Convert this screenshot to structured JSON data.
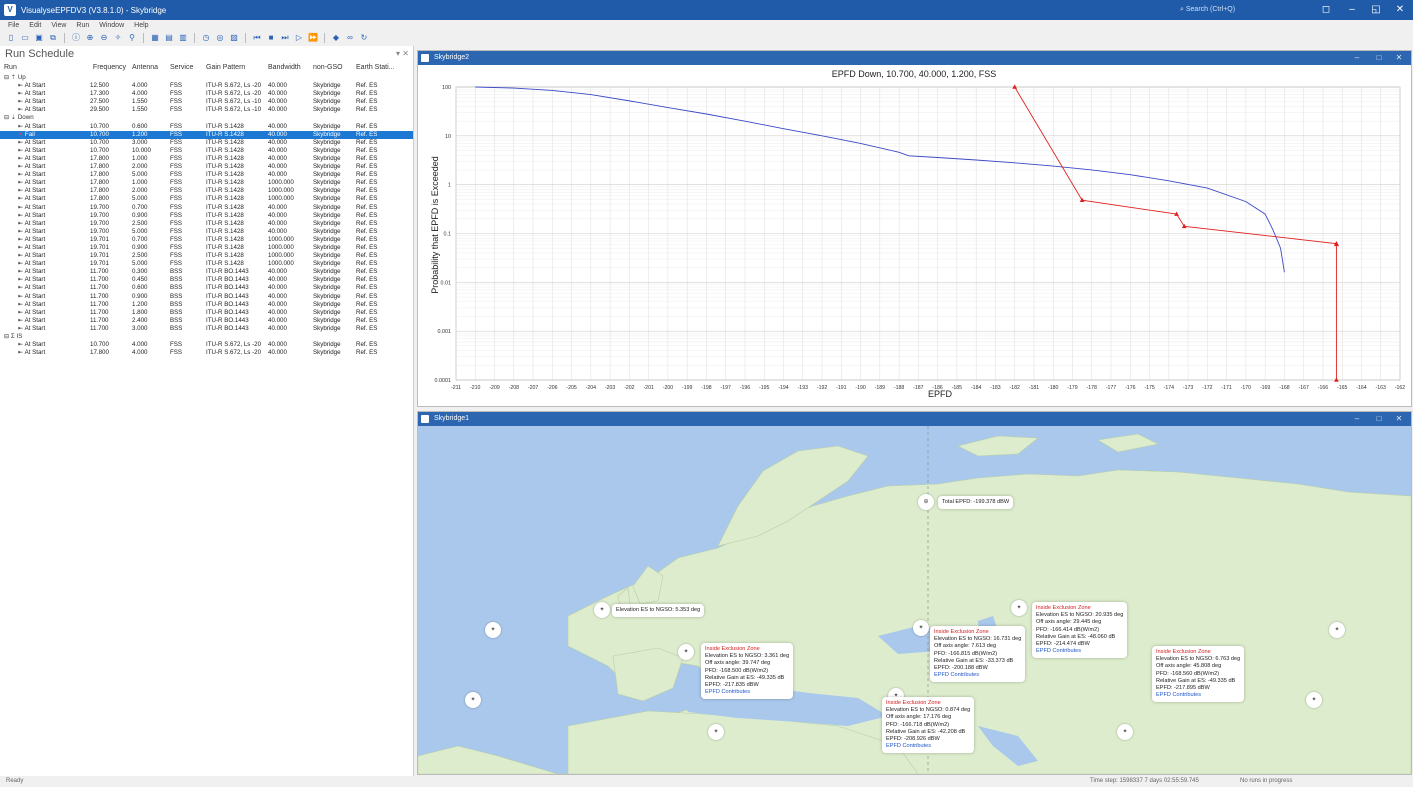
{
  "app": {
    "title": "VisualyseEPFDV3 (V3.8.1.0) - Skybridge",
    "search_placeholder": "Search (Ctrl+Q)"
  },
  "menu": [
    "File",
    "Edit",
    "View",
    "Run",
    "Window",
    "Help"
  ],
  "run_schedule": {
    "title": "Run Schedule",
    "columns": [
      "Run",
      "Frequency",
      "Antenna",
      "Service",
      "Gain Pattern",
      "Bandwidth",
      "non-GSO",
      "Earth Stati..."
    ],
    "groups": [
      {
        "label": "Up",
        "rows": [
          [
            "At Start",
            "12.500",
            "4.000",
            "FSS",
            "ITU-R S.672, Ls -20",
            "40.000",
            "Skybridge",
            "Ref. ES"
          ],
          [
            "At Start",
            "17.300",
            "4.000",
            "FSS",
            "ITU-R S.672, Ls -20",
            "40.000",
            "Skybridge",
            "Ref. ES"
          ],
          [
            "At Start",
            "27.500",
            "1.550",
            "FSS",
            "ITU-R S.672, Ls -10",
            "40.000",
            "Skybridge",
            "Ref. ES"
          ],
          [
            "At Start",
            "29.500",
            "1.550",
            "FSS",
            "ITU-R S.672, Ls -10",
            "40.000",
            "Skybridge",
            "Ref. ES"
          ]
        ]
      },
      {
        "label": "Down",
        "rows": [
          [
            "At Start",
            "10.700",
            "0.600",
            "FSS",
            "ITU-R S.1428",
            "40.000",
            "Skybridge",
            "Ref. ES"
          ],
          [
            "Fail",
            "10.700",
            "1.200",
            "FSS",
            "ITU-R S.1428",
            "40.000",
            "Skybridge",
            "Ref. ES"
          ],
          [
            "At Start",
            "10.700",
            "3.000",
            "FSS",
            "ITU-R S.1428",
            "40.000",
            "Skybridge",
            "Ref. ES"
          ],
          [
            "At Start",
            "10.700",
            "10.000",
            "FSS",
            "ITU-R S.1428",
            "40.000",
            "Skybridge",
            "Ref. ES"
          ],
          [
            "At Start",
            "17.800",
            "1.000",
            "FSS",
            "ITU-R S.1428",
            "40.000",
            "Skybridge",
            "Ref. ES"
          ],
          [
            "At Start",
            "17.800",
            "2.000",
            "FSS",
            "ITU-R S.1428",
            "40.000",
            "Skybridge",
            "Ref. ES"
          ],
          [
            "At Start",
            "17.800",
            "5.000",
            "FSS",
            "ITU-R S.1428",
            "40.000",
            "Skybridge",
            "Ref. ES"
          ],
          [
            "At Start",
            "17.800",
            "1.000",
            "FSS",
            "ITU-R S.1428",
            "1000.000",
            "Skybridge",
            "Ref. ES"
          ],
          [
            "At Start",
            "17.800",
            "2.000",
            "FSS",
            "ITU-R S.1428",
            "1000.000",
            "Skybridge",
            "Ref. ES"
          ],
          [
            "At Start",
            "17.800",
            "5.000",
            "FSS",
            "ITU-R S.1428",
            "1000.000",
            "Skybridge",
            "Ref. ES"
          ],
          [
            "At Start",
            "19.700",
            "0.700",
            "FSS",
            "ITU-R S.1428",
            "40.000",
            "Skybridge",
            "Ref. ES"
          ],
          [
            "At Start",
            "19.700",
            "0.900",
            "FSS",
            "ITU-R S.1428",
            "40.000",
            "Skybridge",
            "Ref. ES"
          ],
          [
            "At Start",
            "19.700",
            "2.500",
            "FSS",
            "ITU-R S.1428",
            "40.000",
            "Skybridge",
            "Ref. ES"
          ],
          [
            "At Start",
            "19.700",
            "5.000",
            "FSS",
            "ITU-R S.1428",
            "40.000",
            "Skybridge",
            "Ref. ES"
          ],
          [
            "At Start",
            "19.701",
            "0.700",
            "FSS",
            "ITU-R S.1428",
            "1000.000",
            "Skybridge",
            "Ref. ES"
          ],
          [
            "At Start",
            "19.701",
            "0.900",
            "FSS",
            "ITU-R S.1428",
            "1000.000",
            "Skybridge",
            "Ref. ES"
          ],
          [
            "At Start",
            "19.701",
            "2.500",
            "FSS",
            "ITU-R S.1428",
            "1000.000",
            "Skybridge",
            "Ref. ES"
          ],
          [
            "At Start",
            "19.701",
            "5.000",
            "FSS",
            "ITU-R S.1428",
            "1000.000",
            "Skybridge",
            "Ref. ES"
          ],
          [
            "At Start",
            "11.700",
            "0.300",
            "BSS",
            "ITU-R BO.1443",
            "40.000",
            "Skybridge",
            "Ref. ES"
          ],
          [
            "At Start",
            "11.700",
            "0.450",
            "BSS",
            "ITU-R BO.1443",
            "40.000",
            "Skybridge",
            "Ref. ES"
          ],
          [
            "At Start",
            "11.700",
            "0.600",
            "BSS",
            "ITU-R BO.1443",
            "40.000",
            "Skybridge",
            "Ref. ES"
          ],
          [
            "At Start",
            "11.700",
            "0.900",
            "BSS",
            "ITU-R BO.1443",
            "40.000",
            "Skybridge",
            "Ref. ES"
          ],
          [
            "At Start",
            "11.700",
            "1.200",
            "BSS",
            "ITU-R BO.1443",
            "40.000",
            "Skybridge",
            "Ref. ES"
          ],
          [
            "At Start",
            "11.700",
            "1.800",
            "BSS",
            "ITU-R BO.1443",
            "40.000",
            "Skybridge",
            "Ref. ES"
          ],
          [
            "At Start",
            "11.700",
            "2.400",
            "BSS",
            "ITU-R BO.1443",
            "40.000",
            "Skybridge",
            "Ref. ES"
          ],
          [
            "At Start",
            "11.700",
            "3.000",
            "BSS",
            "ITU-R BO.1443",
            "40.000",
            "Skybridge",
            "Ref. ES"
          ]
        ]
      },
      {
        "label": "IS",
        "rows": [
          [
            "At Start",
            "10.700",
            "4.000",
            "FSS",
            "ITU-R S.672, Ls -20",
            "40.000",
            "Skybridge",
            "Ref. ES"
          ],
          [
            "At Start",
            "17.800",
            "4.000",
            "FSS",
            "ITU-R S.672, Ls -20",
            "40.000",
            "Skybridge",
            "Ref. ES"
          ]
        ]
      }
    ],
    "selected_label": "Fail"
  },
  "chart_window": {
    "title": "Skybridge2"
  },
  "map_window": {
    "title": "Skybridge1"
  },
  "chart_data": {
    "type": "line",
    "title": "EPFD Down, 10.700, 40.000, 1.200, FSS",
    "xlabel": "EPFD",
    "ylabel": "Probability that EPFD is Exceeded",
    "yscale": "log",
    "xlim": [
      -211,
      -162
    ],
    "ylim": [
      0.0001,
      100
    ],
    "xticks": [
      "-211",
      "-210",
      "-209",
      "-208",
      "-207",
      "-206",
      "-205",
      "-204",
      "-203",
      "-202",
      "-201",
      "-200",
      "-199",
      "-198",
      "-197",
      "-196",
      "-195",
      "-194",
      "-193",
      "-192",
      "-191",
      "-190",
      "-189",
      "-188",
      "-187",
      "-186",
      "-185",
      "-184",
      "-183",
      "-182",
      "-181",
      "-180",
      "-179",
      "-178",
      "-177",
      "-176",
      "-175",
      "-174",
      "-173",
      "-172",
      "-171",
      "-170",
      "-169",
      "-168",
      "-167",
      "-166",
      "-165",
      "-164",
      "-163",
      "-162"
    ],
    "yticks": [
      "100",
      "10",
      "1",
      "0.1",
      "0.01",
      "0.001",
      "0.0001"
    ],
    "series": [
      {
        "color": "#3b48c8",
        "x": [
          -210,
          -208,
          -206,
          -204,
          -202,
          -200,
          -198,
          -196,
          -194,
          -192,
          -190,
          -188,
          -187.5,
          -186,
          -184,
          -182,
          -180,
          -178,
          -176,
          -174,
          -172,
          -170,
          -169,
          -168.6,
          -168.2,
          -168
        ],
        "y": [
          100,
          95,
          85,
          70,
          52,
          38,
          28,
          20,
          14,
          10,
          7,
          4.6,
          3.9,
          3.6,
          3.2,
          2.8,
          2.4,
          2.0,
          1.6,
          1.2,
          0.85,
          0.45,
          0.25,
          0.12,
          0.05,
          0.016
        ]
      },
      {
        "color": "#e02020",
        "marker": "triangle",
        "x": [
          -182,
          -178.5,
          -173.6,
          -173.2,
          -165.3,
          -165.3,
          -165.3
        ],
        "y": [
          100,
          0.48,
          0.25,
          0.14,
          0.062,
          0.06,
          0.0001
        ]
      }
    ]
  },
  "map": {
    "total_epfd": "Total EPFD: -199.378 dBW",
    "elevation_label": "Elevation ES to NGSO: 5.353 deg",
    "popups": [
      {
        "zone": "Inside Exclusion Zone",
        "lines": [
          "Elevation ES to NGSO: 3.361 deg",
          "Off axis angle: 39.747 deg",
          "PFD: -168.500 dB(W/m2)",
          "Relative Gain at ES: -49.335 dB",
          "EPFD: -217.835 dBW"
        ],
        "link": "EPFD Contributes"
      },
      {
        "zone": "Inside Exclusion Zone",
        "lines": [
          "Elevation ES to NGSO: 16.731 deg",
          "Off axis angle: 7.613 deg",
          "PFD: -166.815 dB(W/m2)",
          "Relative Gain at ES: -33.373 dB",
          "EPFD: -200.188 dBW"
        ],
        "link": "EPFD Contributes"
      },
      {
        "zone": "Inside Exclusion Zone",
        "lines": [
          "Elevation ES to NGSO: 20.935 deg",
          "Off axis angle: 29.445 deg",
          "PFD: -166.414 dB(W/m2)",
          "Relative Gain at ES: -48.060 dB",
          "EPFD: -214.474 dBW"
        ],
        "link": "EPFD Contributes"
      },
      {
        "zone": "Inside Exclusion Zone",
        "lines": [
          "Elevation ES to NGSO: 0.874 deg",
          "Off axis angle: 17.176 deg",
          "PFD: -166.718 dB(W/m2)",
          "Relative Gain at ES: -42.208 dB",
          "EPFD: -208.926 dBW"
        ],
        "link": "EPFD Contributes"
      },
      {
        "zone": "Inside Exclusion Zone",
        "lines": [
          "Elevation ES to NGSO: 6.763 deg",
          "Off axis angle: 45.808 deg",
          "PFD: -168.560 dB(W/m2)",
          "Relative Gain at ES: -49.335 dB",
          "EPFD: -217.895 dBW"
        ],
        "link": "EPFD Contributes"
      }
    ]
  },
  "status": {
    "left": "Ready",
    "time": "Time step: 1598337 7 days 02:55:59.745",
    "runs": "No runs in progress"
  }
}
